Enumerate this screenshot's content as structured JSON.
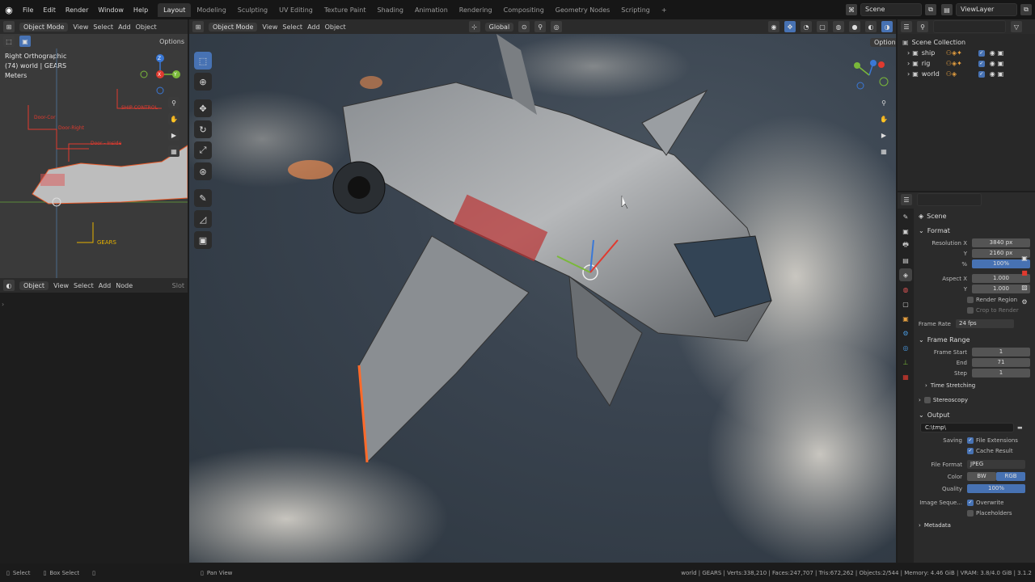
{
  "topbar": {
    "menus": [
      "File",
      "Edit",
      "Render",
      "Window",
      "Help"
    ],
    "workspaces": [
      "Layout",
      "Modeling",
      "Sculpting",
      "UV Editing",
      "Texture Paint",
      "Shading",
      "Animation",
      "Rendering",
      "Compositing",
      "Geometry Nodes",
      "Scripting"
    ],
    "active_workspace": "Layout",
    "add_tab": "+",
    "scene": "Scene",
    "view_layer": "ViewLayer"
  },
  "left_view": {
    "mode": "Object Mode",
    "menus": [
      "View",
      "Select",
      "Add",
      "Object"
    ],
    "options": "Options",
    "overlay_line1": "Right Orthographic",
    "overlay_line2": "(74) world | GEARS",
    "overlay_line3": "Meters",
    "labels": [
      "SHIP CONTROL",
      "Door-Cor",
      "Door-Right",
      "Door - Inside",
      "GEARS"
    ],
    "axis_labels": [
      "Z",
      "Y",
      "X"
    ]
  },
  "node_editor": {
    "type": "Object",
    "menus": [
      "View",
      "Select",
      "Add",
      "Node"
    ],
    "slot": "Slot"
  },
  "main_view": {
    "mode": "Object Mode",
    "menus": [
      "View",
      "Select",
      "Add",
      "Object"
    ],
    "orientation": "Global",
    "options": "Options"
  },
  "outliner": {
    "root": "Scene Collection",
    "items": [
      "ship",
      "rig",
      "world"
    ]
  },
  "properties": {
    "context": "Scene",
    "format_panel": "Format",
    "resolution_x_label": "Resolution X",
    "resolution_x": "3840 px",
    "y_label": "Y",
    "resolution_y": "2160 px",
    "percent_label": "%",
    "percent": "100%",
    "aspect_x_label": "Aspect X",
    "aspect_x": "1.000",
    "aspect_y": "1.000",
    "render_region": "Render Region",
    "crop": "Crop to Render",
    "frame_rate_label": "Frame Rate",
    "frame_rate": "24 fps",
    "frame_range_panel": "Frame Range",
    "frame_start_label": "Frame Start",
    "frame_start": "1",
    "end_label": "End",
    "frame_end": "71",
    "step_label": "Step",
    "step": "1",
    "time_stretching": "Time Stretching",
    "stereoscopy": "Stereoscopy",
    "output_panel": "Output",
    "output_path": "C:\\tmp\\",
    "saving_label": "Saving",
    "file_ext": "File Extensions",
    "cache_result": "Cache Result",
    "file_format_label": "File Format",
    "file_format": "JPEG",
    "color_label": "Color",
    "color_bw": "BW",
    "color_rgb": "RGB",
    "quality_label": "Quality",
    "quality": "100%",
    "image_seq_label": "Image Seque...",
    "overwrite": "Overwrite",
    "placeholders": "Placeholders",
    "metadata": "Metadata"
  },
  "status": {
    "select": "Select",
    "box_select": "Box Select",
    "pan_view": "Pan View",
    "stats": "world | GEARS | Verts:338,210 | Faces:247,707 | Tris:672,262 | Objects:2/544 | Memory: 4.46 GiB | VRAM: 3.8/4.0 GiB | 3.1.2"
  },
  "colors": {
    "accent": "#4772b3",
    "red_label": "#e03a2f"
  }
}
